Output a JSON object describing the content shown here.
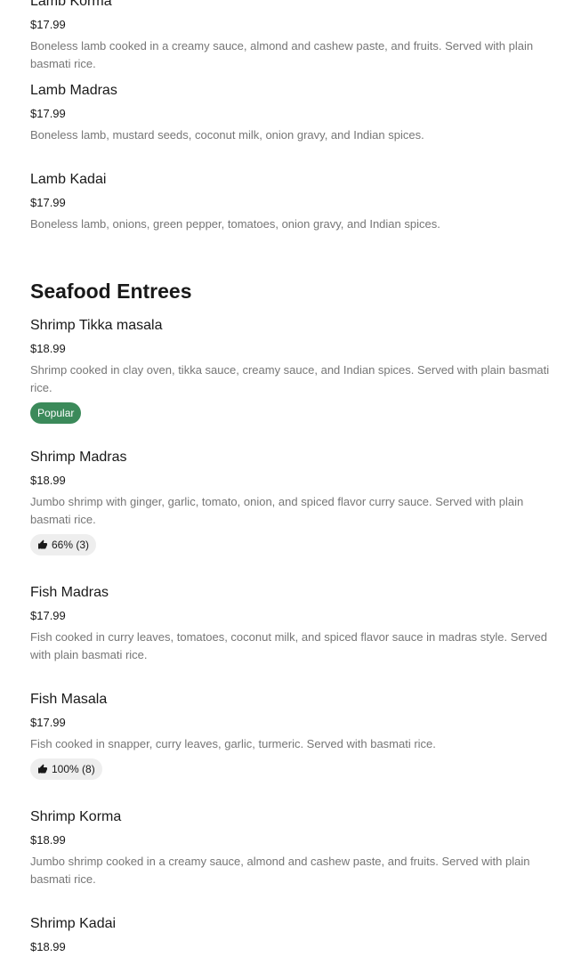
{
  "lamb_items": [
    {
      "name": "Lamb Korma",
      "price": "$17.99",
      "description": "Boneless lamb cooked in a creamy sauce, almond and cashew paste, and fruits. Served with plain basmati rice."
    },
    {
      "name": "Lamb Madras",
      "price": "$17.99",
      "description": "Boneless lamb, mustard seeds, coconut milk, onion gravy, and Indian spices."
    },
    {
      "name": "Lamb Kadai",
      "price": "$17.99",
      "description": "Boneless lamb, onions, green pepper, tomatoes, onion gravy, and Indian spices."
    }
  ],
  "seafood": {
    "title": "Seafood Entrees",
    "items": [
      {
        "name": "Shrimp Tikka masala",
        "price": "$18.99",
        "description": "Shrimp cooked in clay oven, tikka sauce, creamy sauce, and Indian spices. Served with plain basmati rice.",
        "badge": "Popular"
      },
      {
        "name": "Shrimp Madras",
        "price": "$18.99",
        "description": "Jumbo shrimp with ginger, garlic, tomato, onion, and spiced flavor curry sauce. Served with plain basmati rice.",
        "rating": "66% (3)",
        "rating_icon": "thumbs-up-icon"
      },
      {
        "name": "Fish Madras",
        "price": "$17.99",
        "description": "Fish cooked in curry leaves, tomatoes, coconut milk, and spiced flavor sauce in madras style. Served with plain basmati rice."
      },
      {
        "name": "Fish Masala",
        "price": "$17.99",
        "description": "Fish cooked in snapper, curry leaves, garlic, turmeric. Served with basmati rice.",
        "rating": "100% (8)",
        "rating_icon": "thumbs-up-icon"
      },
      {
        "name": "Shrimp Korma",
        "price": "$18.99",
        "description": "Jumbo shrimp cooked in a creamy sauce, almond and cashew paste, and fruits. Served with plain basmati rice."
      },
      {
        "name": "Shrimp Kadai",
        "price": "$18.99"
      }
    ]
  },
  "colors": {
    "popular_badge": "#3b8a5a",
    "rating_badge": "#eeeeee",
    "description_text": "#767676"
  }
}
